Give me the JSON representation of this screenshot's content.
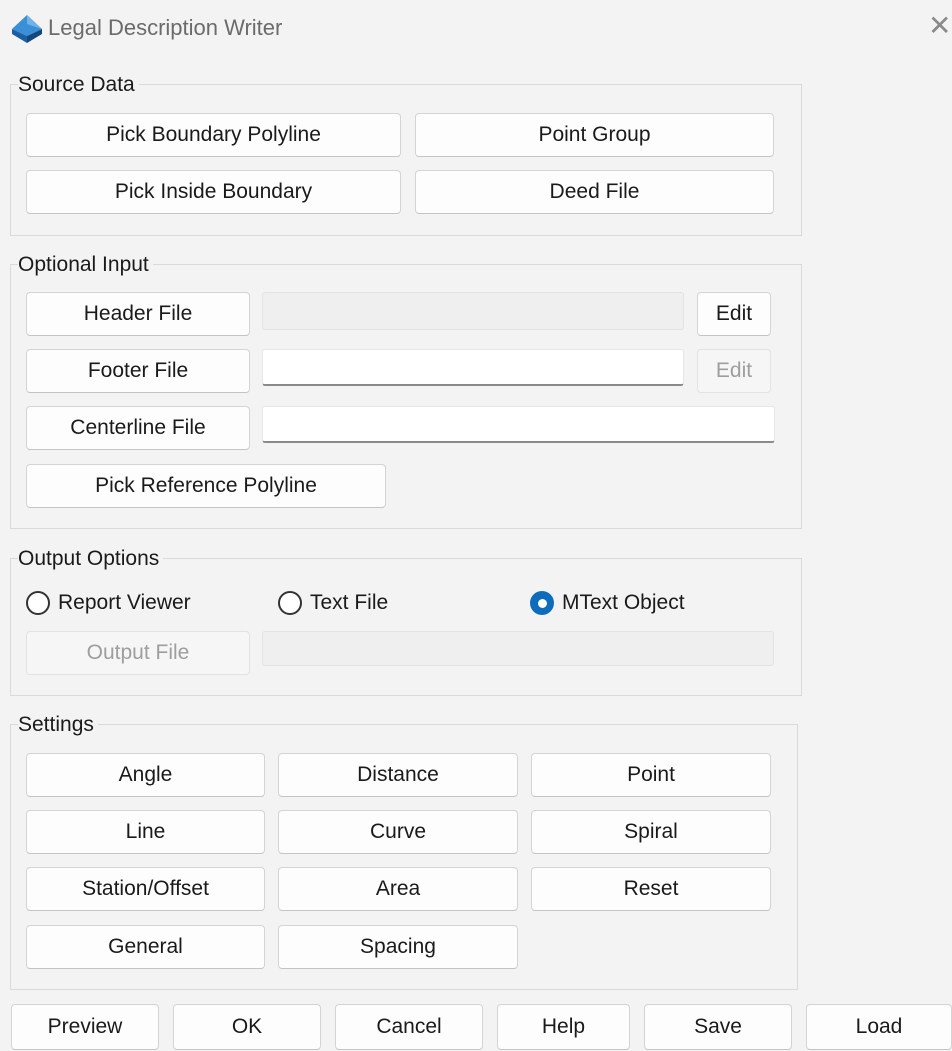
{
  "window": {
    "title": "Legal Description Writer",
    "close_glyph": "✕",
    "icon": "civil-3d-app-icon"
  },
  "source_data": {
    "legend": "Source Data",
    "pick_boundary_polyline": "Pick Boundary Polyline",
    "point_group": "Point Group",
    "pick_inside_boundary": "Pick Inside Boundary",
    "deed_file": "Deed File"
  },
  "optional_input": {
    "legend": "Optional Input",
    "header_file": "Header File",
    "header_file_value": "",
    "header_edit": "Edit",
    "footer_file": "Footer File",
    "footer_file_value": "",
    "footer_edit": "Edit",
    "centerline_file": "Centerline File",
    "centerline_file_value": "",
    "pick_reference_polyline": "Pick Reference Polyline"
  },
  "output_options": {
    "legend": "Output Options",
    "radios": [
      {
        "label": "Report Viewer",
        "selected": false
      },
      {
        "label": "Text File",
        "selected": false
      },
      {
        "label": "MText Object",
        "selected": true
      }
    ],
    "output_file": "Output File",
    "output_file_value": ""
  },
  "settings": {
    "legend": "Settings",
    "angle": "Angle",
    "distance": "Distance",
    "point": "Point",
    "line": "Line",
    "curve": "Curve",
    "spiral": "Spiral",
    "station_offset": "Station/Offset",
    "area": "Area",
    "reset": "Reset",
    "general": "General",
    "spacing": "Spacing"
  },
  "footer_buttons": {
    "preview": "Preview",
    "ok": "OK",
    "cancel": "Cancel",
    "help": "Help",
    "save": "Save",
    "load": "Load"
  },
  "colors": {
    "accent": "#0f6cbd",
    "window_bg": "#f3f3f3",
    "icon_blue": "#1f6fb5"
  }
}
